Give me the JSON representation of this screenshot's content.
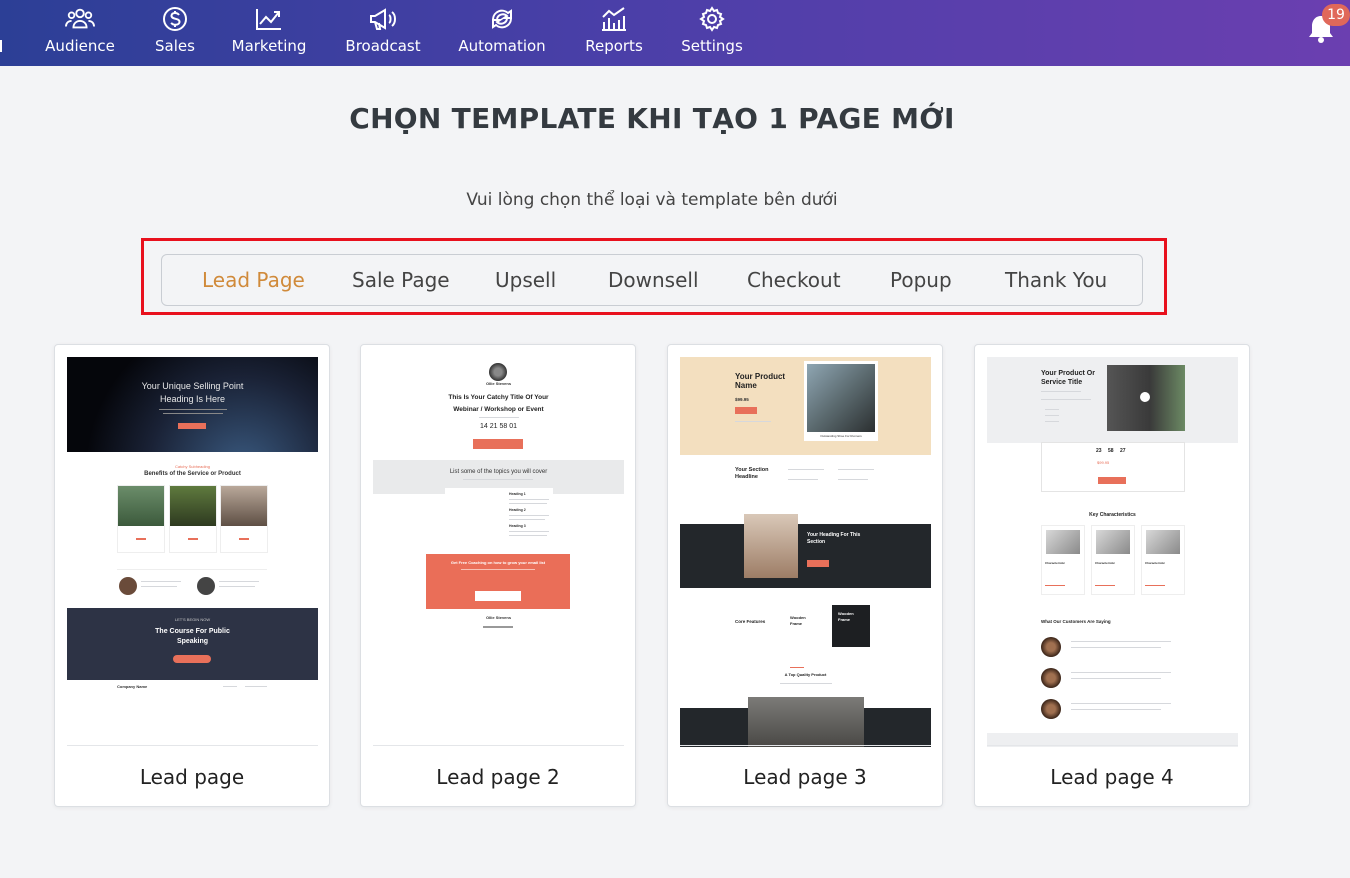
{
  "nav": {
    "items": [
      {
        "label": "Audience",
        "icon": "users-icon"
      },
      {
        "label": "Sales",
        "icon": "dollar-icon"
      },
      {
        "label": "Marketing",
        "icon": "chart-line-icon"
      },
      {
        "label": "Broadcast",
        "icon": "megaphone-icon"
      },
      {
        "label": "Automation",
        "icon": "automation-icon"
      },
      {
        "label": "Reports",
        "icon": "reports-icon"
      },
      {
        "label": "Settings",
        "icon": "gear-icon"
      }
    ],
    "notification_count": "19"
  },
  "page": {
    "title": "CHỌN TEMPLATE KHI TẠO 1 PAGE MỚI",
    "subtitle": "Vui lòng chọn thể loại và template bên dưới"
  },
  "tabs": {
    "items": [
      "Lead Page",
      "Sale Page",
      "Upsell",
      "Downsell",
      "Checkout",
      "Popup",
      "Thank You"
    ],
    "active": "Lead Page"
  },
  "colors": {
    "accent": "#d08a3a",
    "highlight_border": "#e8101d",
    "nav_gradient_start": "#2c3f96",
    "nav_gradient_end": "#6b3fb0",
    "template_orange": "#e8705a",
    "badge": "#e0685a"
  },
  "templates": [
    {
      "label": "Lead page",
      "preview": {
        "hero_line1": "Your Unique Selling Point",
        "hero_line2": "Heading Is Here",
        "eyebrow": "Catchy Subheading",
        "section_title": "Benefits of the Service or Product",
        "banner_eyebrow": "LET'S BEGIN NOW",
        "banner_line1": "The Course For Public",
        "banner_line2": "Speaking",
        "footer_company": "Company Name"
      }
    },
    {
      "label": "Lead page 2",
      "preview": {
        "host_name": "Ollie Stevens",
        "title_line1": "This Is Your Catchy Title Of Your",
        "title_line2": "Webinar / Workshop or Event",
        "countdown": "14  21  58  01",
        "topics_title": "List some of the topics you will cover",
        "topic1": "Heading 1",
        "topic2": "Heading 2",
        "topic3": "Heading 3",
        "cta_title": "Get Free Coaching on how to grow your email list",
        "footer_name": "Ollie Stevens"
      }
    },
    {
      "label": "Lead page 3",
      "preview": {
        "product_line1": "Your Product",
        "product_line2": "Name",
        "price": "$99.95",
        "image_caption": "Outstanding Shoe For Runners",
        "section_line1": "Your Section",
        "section_line2": "Headline",
        "dark_line1": "Your Heading For This",
        "dark_line2": "Section",
        "core_features": "Core Features",
        "wooden1_line1": "Wooden",
        "wooden1_line2": "Frame",
        "wooden2_line1": "Wooden",
        "wooden2_line2": "Frame",
        "quality_title": "A Top Quality Product"
      }
    },
    {
      "label": "Lead page 4",
      "preview": {
        "product_line1": "Your Product Or",
        "product_line2": "Service Title",
        "countdown_days": "23",
        "countdown_hours": "58",
        "countdown_minutes": "27",
        "price": "$99.95",
        "section_title": "Key Characteristics",
        "char1": "Characteristic",
        "char2": "Characteristic",
        "char3": "Characteristic",
        "testimonials_title": "What Our Customers Are Saying"
      }
    }
  ]
}
